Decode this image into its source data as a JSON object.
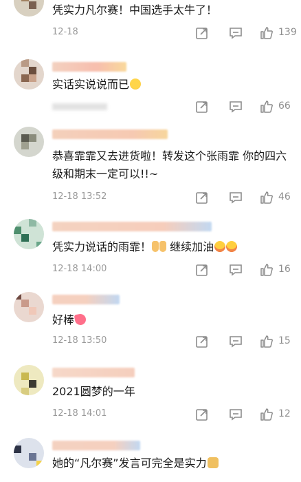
{
  "comments": [
    {
      "text": "凭实力凡尔赛！中国选手太牛了！",
      "time": "12-18",
      "likes": "139"
    },
    {
      "text": "实话实说说而已",
      "time": "",
      "likes": "66"
    },
    {
      "text": "恭喜霏霏又去进货啦！转发这个张雨霏 你的四六级和期末一定可以!!~",
      "time": "12-18 13:52",
      "likes": "46"
    },
    {
      "text": "凭实力说话的雨霏！",
      "text2": "继续加油",
      "time": "12-18 14:00",
      "likes": "16"
    },
    {
      "text": "好棒",
      "time": "12-18 13:50",
      "likes": "15"
    },
    {
      "text": "2021圆梦的一年",
      "time": "12-18 14:01",
      "likes": "12"
    },
    {
      "text": "她的“凡尔赛”发言可完全是实力",
      "time": "",
      "likes": ""
    }
  ],
  "icons": {
    "share": "share-icon",
    "reply": "comment-icon",
    "like": "thumbs-up-icon"
  },
  "colors": {
    "text": "#1a1a1a",
    "meta": "#9a9a9a",
    "icon": "#8c8c8c"
  }
}
